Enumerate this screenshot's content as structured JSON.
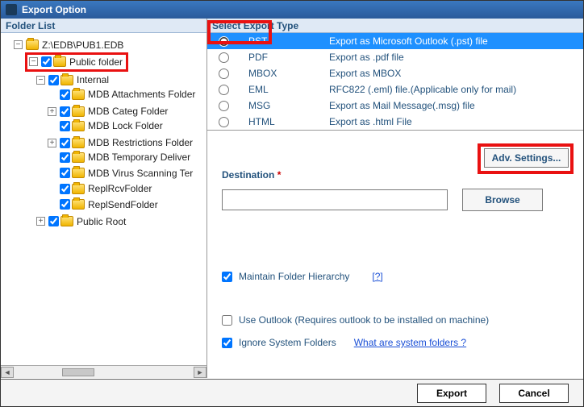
{
  "titlebar": {
    "title": "Export Option"
  },
  "left": {
    "header": "Folder List",
    "tree": {
      "root": "Z:\\EDB\\PUB1.EDB",
      "public_folder": "Public folder",
      "internal": "Internal",
      "items": [
        "MDB Attachments Folder",
        "MDB Categ Folder",
        "MDB Lock Folder",
        "MDB Restrictions Folder",
        "MDB Temporary Deliver",
        "MDB Virus Scanning Ter",
        "ReplRcvFolder",
        "ReplSendFolder"
      ],
      "public_root": "Public Root"
    }
  },
  "right": {
    "header": "Select Export Type",
    "types": [
      {
        "code": "PST",
        "desc": "Export as Microsoft Outlook (.pst) file",
        "selected": true
      },
      {
        "code": "PDF",
        "desc": "Export as .pdf file"
      },
      {
        "code": "MBOX",
        "desc": "Export as MBOX"
      },
      {
        "code": "EML",
        "desc": "RFC822 (.eml) file.(Applicable only for mail)"
      },
      {
        "code": "MSG",
        "desc": "Export as Mail Message(.msg) file"
      },
      {
        "code": "HTML",
        "desc": "Export as .html File"
      }
    ],
    "adv_button": "Adv. Settings...",
    "destination_label": "Destination",
    "destination_value": "",
    "browse": "Browse",
    "maintain": "Maintain Folder Hierarchy",
    "help_q": "[?]",
    "use_outlook": "Use Outlook (Requires outlook to be installed on machine)",
    "ignore_sys": "Ignore System Folders",
    "what_are": "What are system folders ?"
  },
  "footer": {
    "export": "Export",
    "cancel": "Cancel"
  }
}
